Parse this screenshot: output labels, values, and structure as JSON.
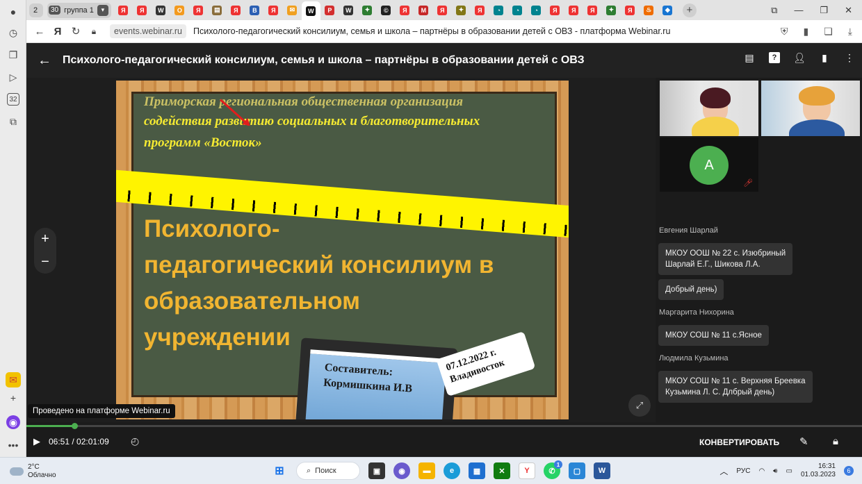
{
  "browser": {
    "tab_count": "2",
    "tab_group": {
      "count": "30",
      "label": "группа 1"
    },
    "tabs": [
      {
        "icon": "yandex-icon",
        "glyph": "Я",
        "color": "#e33"
      },
      {
        "icon": "yandex-icon",
        "glyph": "Я",
        "color": "#e33"
      },
      {
        "icon": "wiki-icon",
        "glyph": "W",
        "color": "#333"
      },
      {
        "icon": "ok-icon",
        "glyph": "О",
        "color": "#f39a1e"
      },
      {
        "icon": "yandex-icon",
        "glyph": "Я",
        "color": "#e33"
      },
      {
        "icon": "doc-icon",
        "glyph": "▤",
        "color": "#8a6d3b"
      },
      {
        "icon": "yandex-icon",
        "glyph": "Я",
        "color": "#e33"
      },
      {
        "icon": "vk-icon",
        "glyph": "В",
        "color": "#2b5fb3"
      },
      {
        "icon": "yandex-icon",
        "glyph": "Я",
        "color": "#e33"
      },
      {
        "icon": "mail-icon",
        "glyph": "✉",
        "color": "#f0a020"
      },
      {
        "icon": "webinar-icon",
        "glyph": "W",
        "color": "#111"
      },
      {
        "icon": "pdf-icon",
        "glyph": "P",
        "color": "#d32f2f"
      },
      {
        "icon": "wiki-icon",
        "glyph": "W",
        "color": "#333"
      },
      {
        "icon": "site-icon",
        "glyph": "✦",
        "color": "#2e7d32"
      },
      {
        "icon": "cc-icon",
        "glyph": "©",
        "color": "#222"
      },
      {
        "icon": "yandex-icon",
        "glyph": "Я",
        "color": "#e33"
      },
      {
        "icon": "mk-icon",
        "glyph": "М",
        "color": "#c62828"
      },
      {
        "icon": "yandex-icon",
        "glyph": "Я",
        "color": "#e33"
      },
      {
        "icon": "site-icon",
        "glyph": "✦",
        "color": "#827717"
      },
      {
        "icon": "yandex-icon",
        "glyph": "Я",
        "color": "#e33"
      },
      {
        "icon": "site-icon",
        "glyph": "◔",
        "color": "#00838f"
      },
      {
        "icon": "site-icon",
        "glyph": "◔",
        "color": "#00838f"
      },
      {
        "icon": "site-icon",
        "glyph": "◔",
        "color": "#00838f"
      },
      {
        "icon": "yandex-icon",
        "glyph": "Я",
        "color": "#e33"
      },
      {
        "icon": "yandex-icon",
        "glyph": "Я",
        "color": "#e33"
      },
      {
        "icon": "yandex-icon",
        "glyph": "Я",
        "color": "#e33"
      },
      {
        "icon": "site-icon",
        "glyph": "✦",
        "color": "#2e7d32"
      },
      {
        "icon": "yandex-icon",
        "glyph": "Я",
        "color": "#e33"
      },
      {
        "icon": "fire-icon",
        "glyph": "♨",
        "color": "#ef6c00"
      },
      {
        "icon": "site-icon",
        "glyph": "◆",
        "color": "#1976d2"
      }
    ],
    "url_host": "events.webinar.ru",
    "page_title": "Психолого-педагогический консилиум, семья и школа – партнёры в образовании детей с ОВЗ - платформа Webinar.ru"
  },
  "app": {
    "title": "Психолого-педагогический консилиум, семья и школа – партнёры в образовании детей с ОВЗ"
  },
  "slide": {
    "org_lines": [
      "Приморская региональная общественная организация",
      "содействия развитию социальных и благотворительных",
      "программ «Восток»"
    ],
    "heading_lines": [
      "Психолого-",
      "педагогический консилиум в",
      "образовательном",
      "учреждении"
    ],
    "author_label": "Составитель:",
    "author_name": "Кормишкина И.В",
    "date": "07.12.2022 г.",
    "city": "Владивосток"
  },
  "participants": {
    "avatar_letter": "А"
  },
  "chat": [
    {
      "author": "Евгения Шарлай",
      "messages": [
        "МКОУ ООШ № 22 с. Изюбриный\nШарлай Е.Г., Шикова Л.А.",
        "Добрый день)"
      ]
    },
    {
      "author": "Маргарита Нихорина",
      "messages": [
        "МКОУ СОШ № 11 с.Ясное"
      ]
    },
    {
      "author": "Людмила Кузьмина",
      "messages": [
        "МКОУ СОШ № 11 с. Верхняя Бреевка\nКузьмина Л. С. Длбрый день)"
      ]
    }
  ],
  "player": {
    "tooltip": "Проведено на платформе Webinar.ru",
    "current_time": "06:51",
    "total_time": "02:01:09",
    "time_separator": " / ",
    "progress_fraction": 0.057,
    "convert_label": "КОНВЕРТИРОВАТЬ"
  },
  "taskbar": {
    "temperature": "2°C",
    "weather": "Облачно",
    "search_label": "Поиск",
    "whatsapp_badge": "1",
    "language": "РУС",
    "time": "16:31",
    "date": "01.03.2023",
    "notifications": "6"
  },
  "colors": {
    "accent_green": "#4caf50",
    "ruler_yellow": "#fff400",
    "heading_orange": "#f1b531"
  }
}
